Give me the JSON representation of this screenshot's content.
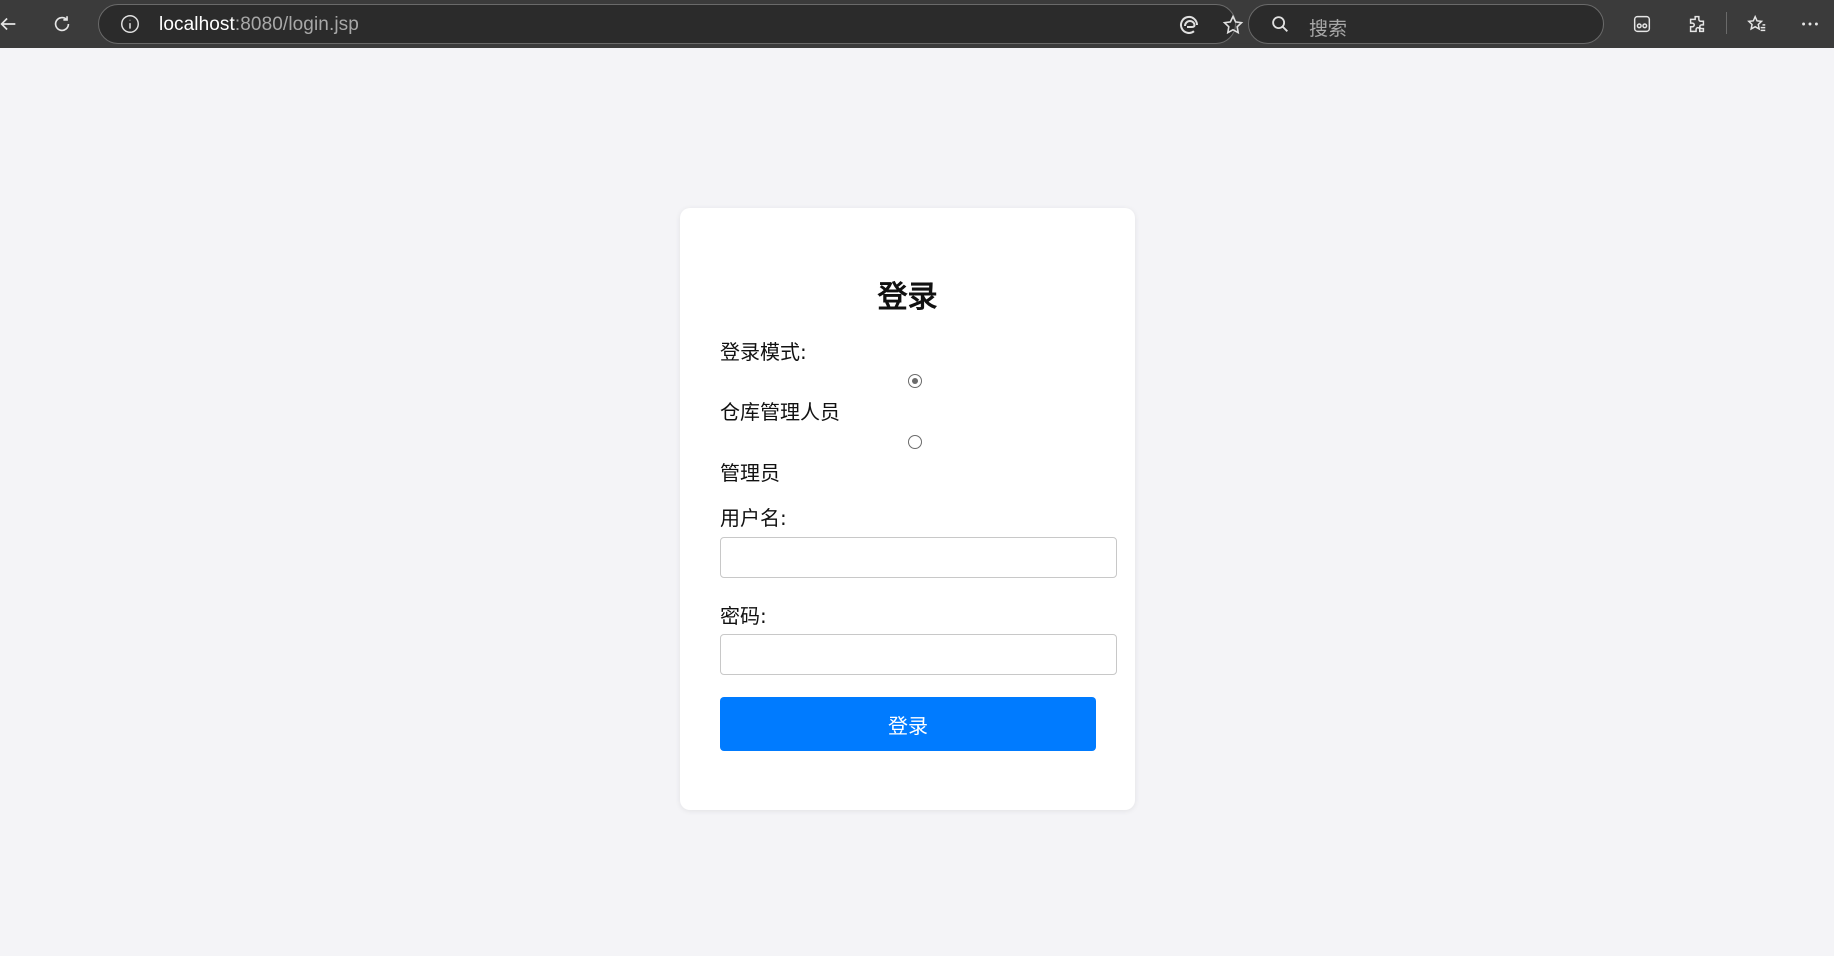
{
  "browser": {
    "url_host": "localhost",
    "url_rest": ":8080/login.jsp",
    "search_placeholder": "搜索"
  },
  "login": {
    "title": "登录",
    "mode_label": "登录模式:",
    "modes": [
      {
        "label": "仓库管理人员",
        "checked": true
      },
      {
        "label": "管理员",
        "checked": false
      }
    ],
    "username_label": "用户名:",
    "username_value": "",
    "password_label": "密码:",
    "password_value": "",
    "submit_label": "登录"
  },
  "colors": {
    "page_bg": "#f4f4f7",
    "toolbar_bg": "#3b3b3b",
    "button": "#007bff"
  }
}
